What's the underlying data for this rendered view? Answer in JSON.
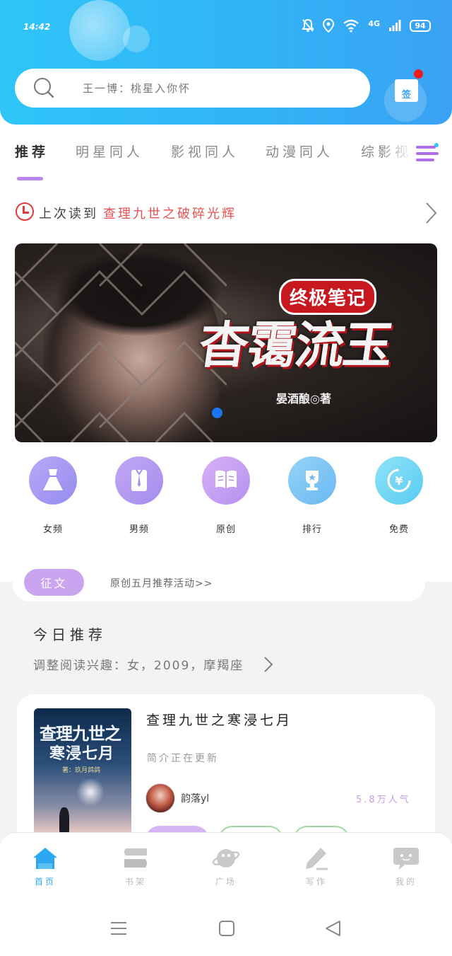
{
  "status_bar": {
    "time": "14:42",
    "network": "4G",
    "battery": "94"
  },
  "search": {
    "placeholder": "王一博：桃星入你怀"
  },
  "signin": {
    "label": "签"
  },
  "category_tabs": [
    {
      "label": "推荐",
      "active": true
    },
    {
      "label": "明星同人",
      "active": false
    },
    {
      "label": "影视同人",
      "active": false
    },
    {
      "label": "动漫同人",
      "active": false
    },
    {
      "label": "综影视",
      "active": false
    }
  ],
  "last_read": {
    "prefix": "上次读到",
    "title": "查理九世之破碎光辉"
  },
  "banner": {
    "badge": "终极笔记",
    "title": "杳霭流玉",
    "author": "晏酒酿◎著",
    "active_slide": 1
  },
  "quick_entries": [
    {
      "label": "女频",
      "icon": "dress-icon",
      "color": "#a79af2"
    },
    {
      "label": "男频",
      "icon": "shirt-icon",
      "color": "#b49af0"
    },
    {
      "label": "原创",
      "icon": "book-icon",
      "color": "#c59bef"
    },
    {
      "label": "排行",
      "icon": "trophy-icon",
      "color": "#7cc6f4"
    },
    {
      "label": "免费",
      "icon": "yuan-coin-icon",
      "color": "#6fd3f3"
    }
  ],
  "notice": {
    "tag": "征文",
    "text": "原创五月推荐活动>>"
  },
  "today": {
    "title": "今日推荐",
    "subtitle": "调整阅读兴趣：女，2009，摩羯座"
  },
  "book": {
    "title": "查理九世之寒浸七月",
    "cover_title_line1": "查理九世之",
    "cover_title_line2": "寒浸七月",
    "cover_author": "著：玖月鸽鸽",
    "description": "简介正在更新",
    "author": "韵落yl",
    "popularity": "5.8万人气"
  },
  "bottom_nav": [
    {
      "label": "首页",
      "icon": "home-icon",
      "active": true
    },
    {
      "label": "书架",
      "icon": "bookshelf-icon",
      "active": false
    },
    {
      "label": "广场",
      "icon": "planet-icon",
      "active": false
    },
    {
      "label": "写作",
      "icon": "pen-icon",
      "active": false
    },
    {
      "label": "我的",
      "icon": "chat-bubble-icon",
      "active": false
    }
  ],
  "colors": {
    "header_start": "#2fc5f8",
    "header_end": "#3aa2f4",
    "accent_purple": "#b985ee",
    "highlight_red": "#e55252",
    "nav_active": "#2ea7f3"
  }
}
